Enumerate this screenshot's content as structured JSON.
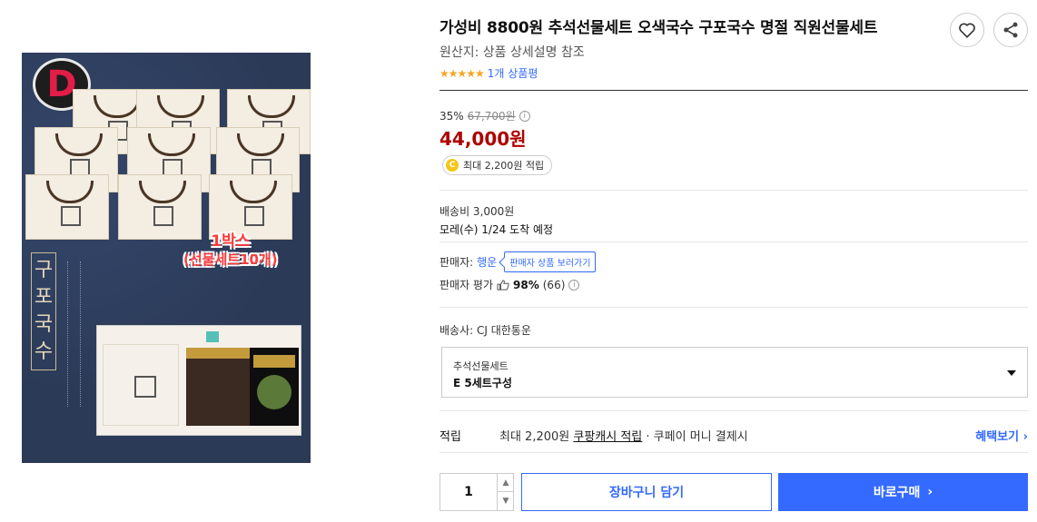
{
  "product": {
    "title": "가성비 8800원 추석선물세트 오색국수 구포국수 명절 직원선물세트",
    "origin": "원산지: 상품 상세설명 참조",
    "stars": "★★★★★",
    "review_count_label": "1개 상품평"
  },
  "image": {
    "badge_letter": "D",
    "label_line1": "1박스",
    "label_line2": "(선물세트10개)",
    "box_title": "구포국수"
  },
  "price": {
    "discount_rate": "35%",
    "original_price": "67,700원",
    "sale_price": "44,000원",
    "reward_badge": "최대 2,200원 적립",
    "coin_letter": "C"
  },
  "shipping": {
    "fee": "배송비 3,000원",
    "arrival": "모레(수) 1/24 도착 예정",
    "carrier": "배송사: CJ 대한통운"
  },
  "seller": {
    "label": "판매자:",
    "name": "행운",
    "store_button": "판매자 상품 보러가기",
    "eval_label": "판매자 평가",
    "eval_percent": "98%",
    "eval_count": "(66)"
  },
  "option": {
    "label": "추석선물세트",
    "value": "E 5세트구성"
  },
  "reward_row": {
    "key": "적립",
    "text_prefix": "최대 2,200원 ",
    "text_link": "쿠팡캐시 적립",
    "text_suffix": " · 쿠페이 머니 결제시",
    "benefit_link": "혜택보기 ›"
  },
  "purchase": {
    "quantity": "1",
    "cart_label": "장바구니 담기",
    "buy_label": "바로구매",
    "buy_chevron": "›"
  },
  "colors": {
    "accent": "#346aff",
    "sale_red": "#ae0000",
    "star": "#f5a623"
  }
}
